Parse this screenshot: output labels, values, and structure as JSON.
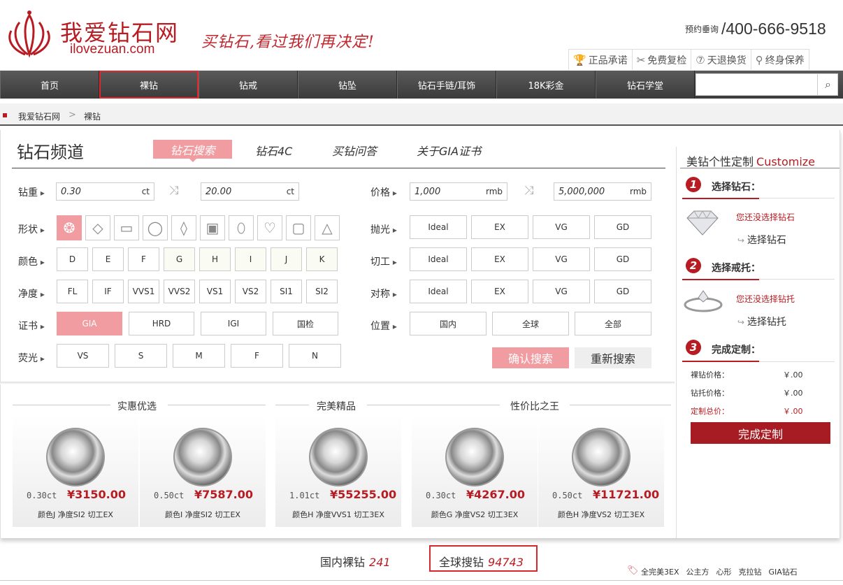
{
  "header": {
    "brand_cn": "我爱钻石网",
    "brand_en": "ilovezuan.com",
    "slogan": "买钻石,看过我们再决定!",
    "hotline_label": "预约垂询",
    "hotline": "/400-666-9518",
    "services": [
      {
        "icon": "trophy-icon",
        "glyph": "🏆",
        "label": "正品承诺"
      },
      {
        "icon": "tools-icon",
        "glyph": "✂",
        "label": "免费复检"
      },
      {
        "icon": "seven-day-icon",
        "glyph": "⑦",
        "label": "天退换货"
      },
      {
        "icon": "care-icon",
        "glyph": "⚲",
        "label": "终身保养"
      }
    ]
  },
  "nav": {
    "items": [
      "首页",
      "裸钻",
      "钻戒",
      "钻坠",
      "钻石手链/耳饰",
      "18K彩金",
      "钻石学堂"
    ],
    "active_index": 1,
    "search_placeholder": ""
  },
  "breadcrumb": {
    "home": "我爱钻石网",
    "current": "裸钻"
  },
  "channel": {
    "title": "钻石频道",
    "tabs": [
      "钻石搜索",
      "钻石4C",
      "买钻问答",
      "关于GIA证书"
    ]
  },
  "search": {
    "weight": {
      "label": "钻重",
      "from": "0.30",
      "to": "20.00",
      "unit": "ct"
    },
    "price": {
      "label": "价格",
      "from": "1,000",
      "to": "5,000,000",
      "unit": "rmb"
    },
    "shape": {
      "label": "形状",
      "options": [
        "round",
        "princess",
        "emerald",
        "oval",
        "marquise",
        "radiant",
        "pear",
        "heart",
        "cushion",
        "triangle"
      ],
      "glyphs": [
        "❂",
        "◇",
        "▭",
        "◯",
        "◊",
        "▣",
        "⬯",
        "♡",
        "▢",
        "△"
      ]
    },
    "color": {
      "label": "颜色",
      "options": [
        "D",
        "E",
        "F",
        "G",
        "H",
        "I",
        "J",
        "K"
      ]
    },
    "clarity": {
      "label": "净度",
      "options": [
        "FL",
        "IF",
        "VVS1",
        "VVS2",
        "VS1",
        "VS2",
        "SI1",
        "SI2"
      ]
    },
    "cert": {
      "label": "证书",
      "options": [
        "GIA",
        "HRD",
        "IGI",
        "国检"
      ]
    },
    "fluor": {
      "label": "荧光",
      "options": [
        "VS",
        "S",
        "M",
        "F",
        "N"
      ]
    },
    "polish": {
      "label": "抛光",
      "options": [
        "Ideal",
        "EX",
        "VG",
        "GD"
      ]
    },
    "cut": {
      "label": "切工",
      "options": [
        "Ideal",
        "EX",
        "VG",
        "GD"
      ]
    },
    "symmetry": {
      "label": "对称",
      "options": [
        "Ideal",
        "EX",
        "VG",
        "GD"
      ]
    },
    "location": {
      "label": "位置",
      "options": [
        "国内",
        "全球",
        "全部"
      ]
    },
    "confirm": "确认搜索",
    "reset": "重新搜索"
  },
  "featured": {
    "sections": [
      "实惠优选",
      "完美精品",
      "性价比之王"
    ],
    "items": [
      {
        "carat": "0.30ct",
        "price": "¥3150.00",
        "spec": "颜色J 净度SI2 切工EX"
      },
      {
        "carat": "0.50ct",
        "price": "¥7587.00",
        "spec": "颜色I 净度SI2 切工EX"
      },
      {
        "carat": "1.01ct",
        "price": "¥55255.00",
        "spec": "颜色H 净度VVS1 切工3EX"
      },
      {
        "carat": "0.30ct",
        "price": "¥4267.00",
        "spec": "颜色G 净度VS2 切工3EX"
      },
      {
        "carat": "0.50ct",
        "price": "¥11721.00",
        "spec": "颜色H 净度VS2 切工3EX"
      }
    ]
  },
  "custom": {
    "title": "美钻个性定制",
    "title_en": "Customize",
    "steps": [
      {
        "num": "1",
        "title": "选择钻石：",
        "note": "您还没选择钻石",
        "action": "选择钻石"
      },
      {
        "num": "2",
        "title": "选择戒托：",
        "note": "您还没选择钻托",
        "action": "选择钻托"
      },
      {
        "num": "3",
        "title": "完成定制："
      }
    ],
    "summary": [
      {
        "label": "裸钻价格：",
        "value": "￥.00"
      },
      {
        "label": "钻托价格：",
        "value": "￥.00"
      },
      {
        "label": "定制总价：",
        "value": "￥.00"
      }
    ],
    "finish": "完成定制"
  },
  "stats": {
    "domestic_label": "国内裸钻",
    "domestic_count": "241",
    "global_label": "全球搜钻",
    "global_count": "94743"
  },
  "hot_tags": [
    "全完美3EX",
    "公主方",
    "心形",
    "克拉钻",
    "GIA钻石"
  ],
  "colors": {
    "brand": "#b81c22",
    "accent_pink": "#f19ca0",
    "nav": "#444444"
  }
}
